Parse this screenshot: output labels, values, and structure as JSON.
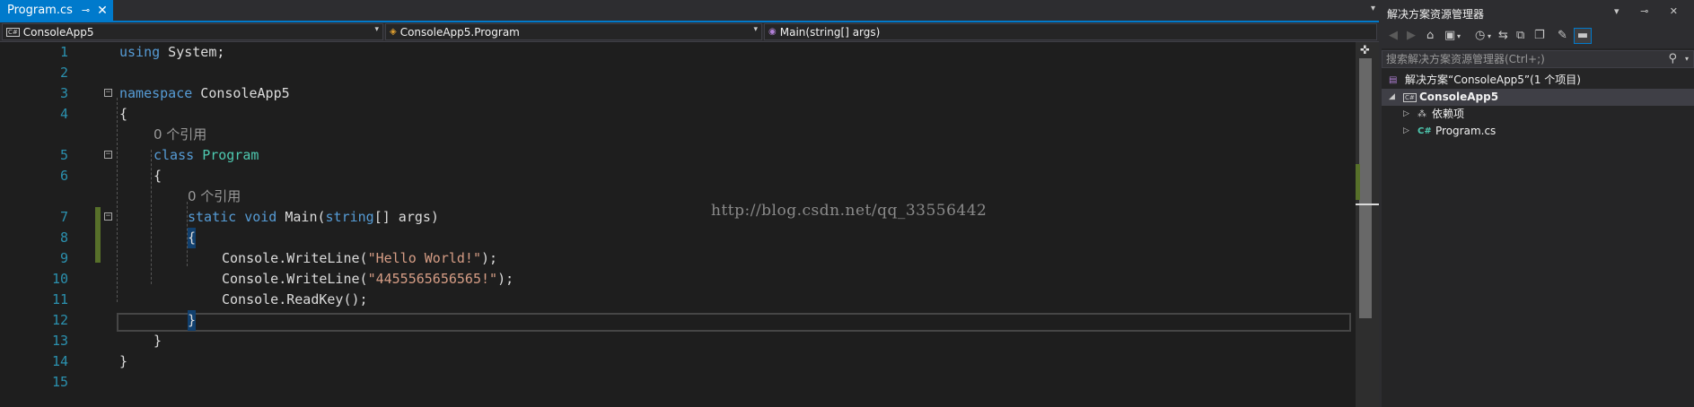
{
  "editor": {
    "tab": {
      "title": "Program.cs",
      "pin_glyph": "⊸",
      "close_glyph": "✕"
    },
    "tab_overflow_glyph": "▾",
    "nav": {
      "project": "ConsoleApp5",
      "type": "ConsoleApp5.Program",
      "member": "Main(string[] args)"
    },
    "line_numbers": [
      "1",
      "2",
      "3",
      "4",
      "5",
      "6",
      "7",
      "8",
      "9",
      "10",
      "11",
      "12",
      "13",
      "14",
      "15"
    ],
    "code": {
      "l1_kw": "using",
      "l1_rest": " System;",
      "l3_kw": "namespace",
      "l3_rest": " ConsoleApp5",
      "l4": "{",
      "ref1": "0 个引用",
      "l5_kw": "class",
      "l5_type": "Program",
      "l6": "{",
      "ref2": "0 个引用",
      "l7_kw1": "static",
      "l7_kw2": "void",
      "l7_name": "Main(",
      "l7_kw3": "string",
      "l7_rest": "[] args)",
      "l8": "{",
      "l9_pre": "Console.WriteLine(",
      "l9_str": "\"Hello World!\"",
      "l9_post": ");",
      "l10_pre": "Console.WriteLine(",
      "l10_str": "\"4455565656565!\"",
      "l10_post": ");",
      "l11": "Console.ReadKey();",
      "l12": "}",
      "l13": "}",
      "l14": "}"
    },
    "watermark": "http://blog.csdn.net/qq_33556442",
    "split_glyph": "✜"
  },
  "solution_explorer": {
    "title": "解决方案资源管理器",
    "title_buttons": "▾ ⊸ ✕",
    "search_placeholder": "搜索解决方案资源管理器(Ctrl+;)",
    "search_icon": "⚲",
    "tree": {
      "solution_label": "解决方案“ConsoleApp5”(1 个项目)",
      "project_label": "ConsoleApp5",
      "deps_label": "依赖项",
      "file_label": "Program.cs"
    }
  },
  "colors": {
    "accent": "#007acc",
    "keyword": "#569cd6",
    "type": "#4ec9b0",
    "string": "#d69d85",
    "line_number": "#2b91af",
    "changed": "#57702a"
  }
}
